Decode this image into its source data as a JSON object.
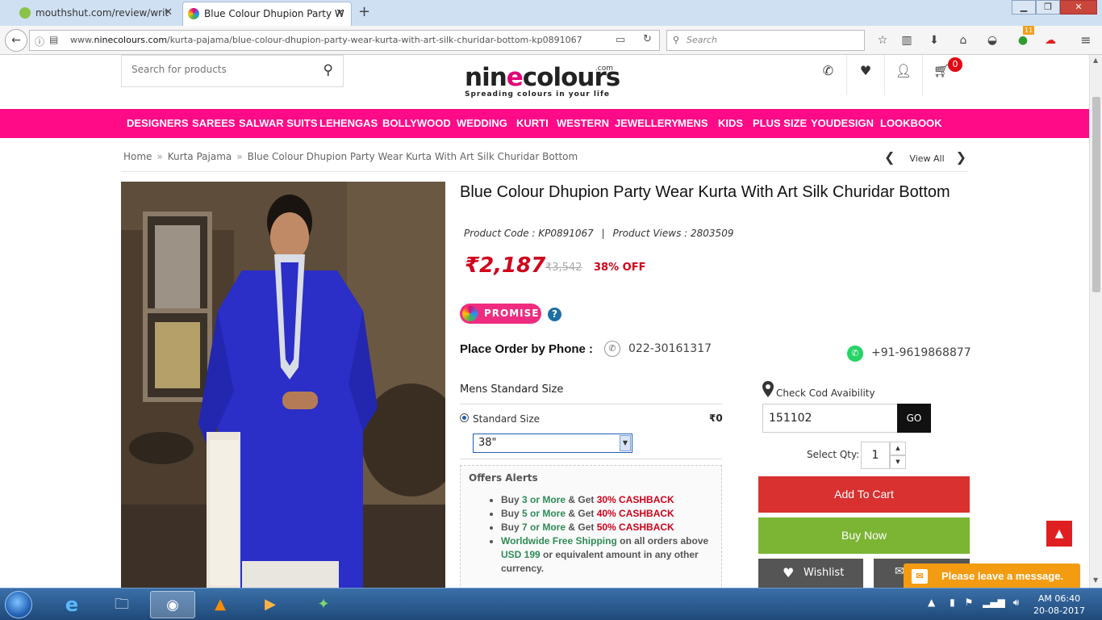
{
  "browser": {
    "tabs": [
      {
        "label": "mouthshut.com/review/writ"
      },
      {
        "label": "Blue Colour Dhupion Party W"
      }
    ],
    "url_prefix": "www.",
    "url_domain": "ninecolours.com",
    "url_path": "/kurta-pajama/blue-colour-dhupion-party-wear-kurta-with-art-silk-churidar-bottom-kp0891067",
    "search_placeholder": "Search",
    "addon_badge": "11"
  },
  "header": {
    "search_placeholder": "Search for products",
    "logo_text_a": "nin",
    "logo_text_e": "e",
    "logo_text_b": "colours",
    "logo_com": ".com",
    "logo_tagline": "Spreading colours in your life",
    "cart_count": "0"
  },
  "menu": [
    "DESIGNERS",
    "SAREES",
    "SALWAR SUITS",
    "LEHENGAS",
    "BOLLYWOOD",
    "WEDDING",
    "KURTI",
    "WESTERN",
    "JEWELLERY",
    "MENS",
    "KIDS",
    "PLUS SIZE",
    "YOUDESIGN",
    "LOOKBOOK"
  ],
  "breadcrumb": {
    "home": "Home",
    "category": "Kurta Pajama",
    "current": "Blue Colour Dhupion Party Wear Kurta With Art Silk Churidar Bottom",
    "view_all": "View All"
  },
  "product": {
    "title": "Blue Colour Dhupion Party Wear Kurta With Art Silk Churidar Bottom",
    "code_label": "Product Code : KP0891067",
    "views_label": "Product Views : 2803509",
    "price": "₹2,187",
    "mrp": "₹3,542",
    "discount": "38% OFF",
    "promise": "PROMISE",
    "order_phone_label": "Place Order by Phone :",
    "order_phone": "022-30161317",
    "whatsapp": "+91-9619868877",
    "size_heading": "Mens Standard Size",
    "size_option": "Standard Size",
    "size_option_price": "₹0",
    "size_selected": "38\""
  },
  "offers": {
    "heading": "Offers Alerts",
    "items": [
      {
        "pre": "Buy ",
        "qty": "3 or More",
        "mid": " & Get ",
        "deal": "30% CASHBACK"
      },
      {
        "pre": "Buy ",
        "qty": "5 or More",
        "mid": " & Get ",
        "deal": "40% CASHBACK"
      },
      {
        "pre": "Buy ",
        "qty": "7 or More",
        "mid": " & Get ",
        "deal": "50% CASHBACK"
      }
    ],
    "shipping_highlight": "Worldwide Free Shipping",
    "shipping_text_1": " on all orders above ",
    "shipping_amount": "USD 199",
    "shipping_text_2": " or equivalent amount in any other currency."
  },
  "purchase": {
    "cod_label": "Check Cod Avaibility",
    "pincode": "151102",
    "go": "GO",
    "qty_label": "Select Qty:",
    "qty": "1",
    "add_to_cart": "Add To Cart",
    "buy_now": "Buy Now",
    "wishlist": "Wishlist",
    "chat": "Please leave a message."
  },
  "taskbar": {
    "time": "AM 06:40",
    "date": "20-08-2017"
  },
  "colors": {
    "menu_bar": "#ff0a87",
    "price": "#d0021b",
    "add_to_cart": "#d93030",
    "buy_now": "#7cb434",
    "chat": "#f39c12"
  }
}
